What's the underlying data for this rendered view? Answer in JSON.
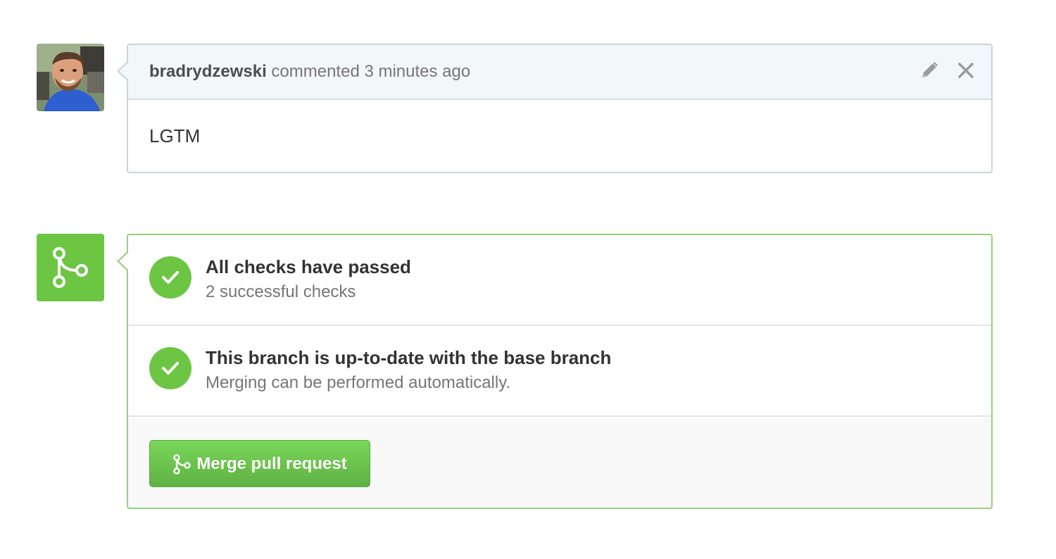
{
  "comment": {
    "author": "bradrydzewski",
    "action_text": "commented 3 minutes ago",
    "body": "LGTM",
    "icons": {
      "edit": "pencil-icon",
      "delete": "close-icon"
    }
  },
  "merge": {
    "checks": [
      {
        "title": "All checks have passed",
        "subtitle": "2 successful checks",
        "icon": "check-icon"
      },
      {
        "title": "This branch is up-to-date with the base branch",
        "subtitle": "Merging can be performed automatically.",
        "icon": "check-icon"
      }
    ],
    "button_label": "Merge pull request",
    "icon": "git-merge-icon"
  },
  "colors": {
    "success_green": "#6cc644",
    "comment_header_bg": "#f2f7fa",
    "border_blue_gray": "#c9d4de",
    "border_green": "#95d07e"
  }
}
